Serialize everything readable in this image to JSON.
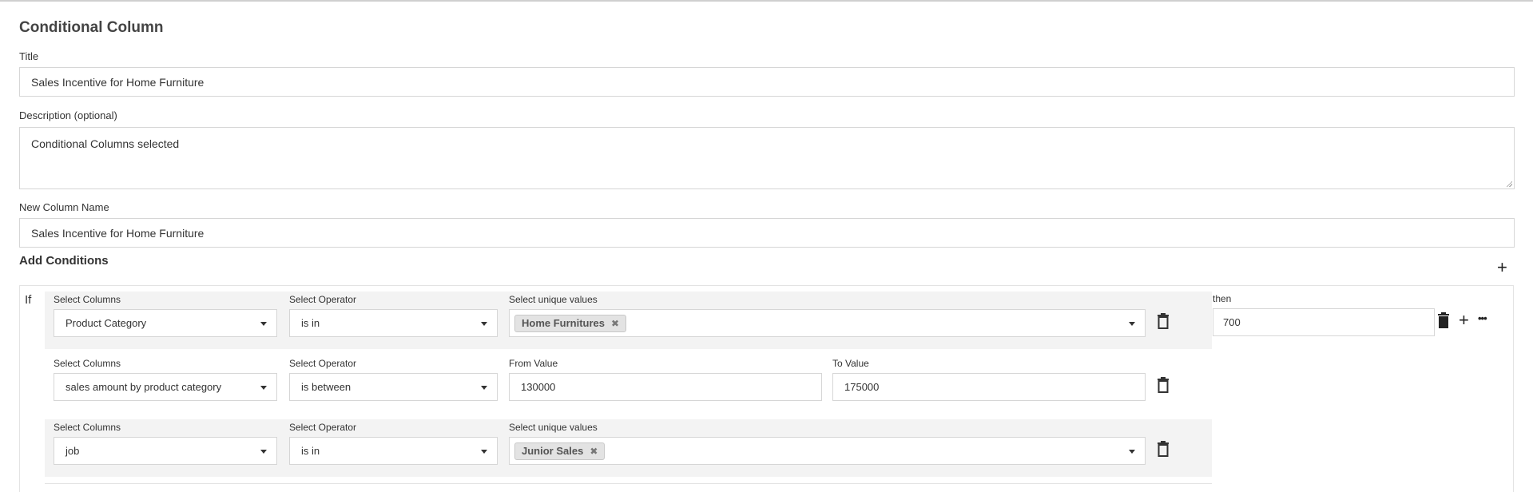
{
  "page": {
    "title": "Conditional Column"
  },
  "form": {
    "title_label": "Title",
    "title_value": "Sales Incentive for Home Furniture",
    "description_label": "Description (optional)",
    "description_value": "Conditional Columns selected",
    "new_column_label": "New Column Name",
    "new_column_value": "Sales Incentive for Home Furniture"
  },
  "conditions": {
    "heading": "Add Conditions",
    "add_icon": "plus-icon",
    "if_label": "If",
    "then_label": "then",
    "then_value": "700",
    "rows": [
      {
        "columns_label": "Select Columns",
        "column_value": "Product Category",
        "operator_label": "Select Operator",
        "operator_value": "is in",
        "values_label": "Select unique values",
        "chip": "Home Furnitures"
      },
      {
        "columns_label": "Select Columns",
        "column_value": "sales amount by product category",
        "operator_label": "Select Operator",
        "operator_value": "is between",
        "from_label": "From Value",
        "from_value": "130000",
        "to_label": "To Value",
        "to_value": "175000"
      },
      {
        "columns_label": "Select Columns",
        "column_value": "job",
        "operator_label": "Select Operator",
        "operator_value": "is in",
        "values_label": "Select unique values",
        "chip": "Junior Sales"
      }
    ],
    "chip_remove_glyph": "✖",
    "more_glyph": "•••",
    "plus_glyph": "+"
  }
}
